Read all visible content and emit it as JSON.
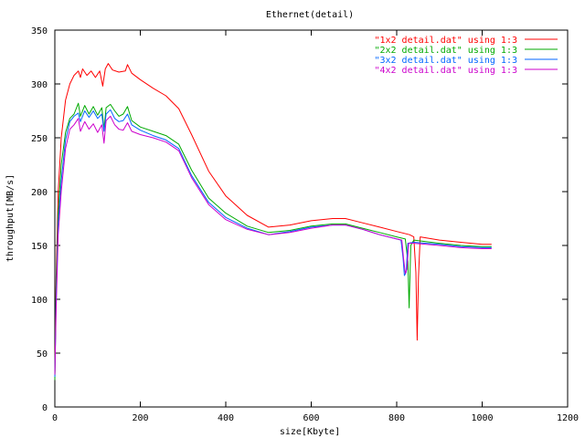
{
  "chart_data": {
    "type": "line",
    "title": "Ethernet(detail)",
    "xlabel": "size[Kbyte]",
    "ylabel": "throughput[MB/s]",
    "xlim": [
      0,
      1200
    ],
    "ylim": [
      0,
      350
    ],
    "xticks": [
      0,
      200,
      400,
      600,
      800,
      1000,
      1200
    ],
    "yticks": [
      0,
      50,
      100,
      150,
      200,
      250,
      300,
      350
    ],
    "grid": false,
    "legend_position": "top-right",
    "series": [
      {
        "name": "\"1x2 detail.dat\" using 1:3",
        "color": "#ff0000",
        "points": [
          [
            0,
            30
          ],
          [
            3,
            120
          ],
          [
            8,
            200
          ],
          [
            15,
            250
          ],
          [
            25,
            285
          ],
          [
            35,
            300
          ],
          [
            45,
            308
          ],
          [
            55,
            312
          ],
          [
            60,
            306
          ],
          [
            65,
            314
          ],
          [
            75,
            308
          ],
          [
            85,
            312
          ],
          [
            95,
            306
          ],
          [
            105,
            312
          ],
          [
            112,
            298
          ],
          [
            118,
            314
          ],
          [
            125,
            319
          ],
          [
            135,
            313
          ],
          [
            150,
            311
          ],
          [
            165,
            312
          ],
          [
            170,
            318
          ],
          [
            180,
            310
          ],
          [
            200,
            304
          ],
          [
            230,
            296
          ],
          [
            260,
            289
          ],
          [
            290,
            277
          ],
          [
            320,
            253
          ],
          [
            360,
            219
          ],
          [
            400,
            196
          ],
          [
            450,
            178
          ],
          [
            500,
            167
          ],
          [
            550,
            169
          ],
          [
            600,
            173
          ],
          [
            650,
            175
          ],
          [
            680,
            175
          ],
          [
            720,
            171
          ],
          [
            760,
            167
          ],
          [
            800,
            163
          ],
          [
            830,
            160
          ],
          [
            840,
            158
          ],
          [
            845,
            125
          ],
          [
            848,
            62
          ],
          [
            851,
            120
          ],
          [
            855,
            158
          ],
          [
            900,
            155
          ],
          [
            950,
            153
          ],
          [
            1000,
            151
          ],
          [
            1022,
            151
          ]
        ]
      },
      {
        "name": "\"2x2 detail.dat\" using 1:3",
        "color": "#00aa00",
        "points": [
          [
            0,
            25
          ],
          [
            3,
            110
          ],
          [
            8,
            180
          ],
          [
            15,
            225
          ],
          [
            25,
            255
          ],
          [
            35,
            268
          ],
          [
            45,
            272
          ],
          [
            55,
            282
          ],
          [
            60,
            270
          ],
          [
            70,
            280
          ],
          [
            80,
            272
          ],
          [
            90,
            279
          ],
          [
            100,
            271
          ],
          [
            110,
            278
          ],
          [
            115,
            258
          ],
          [
            120,
            278
          ],
          [
            130,
            281
          ],
          [
            140,
            275
          ],
          [
            150,
            270
          ],
          [
            160,
            272
          ],
          [
            170,
            279
          ],
          [
            180,
            266
          ],
          [
            200,
            260
          ],
          [
            230,
            256
          ],
          [
            260,
            252
          ],
          [
            290,
            244
          ],
          [
            320,
            220
          ],
          [
            360,
            194
          ],
          [
            400,
            180
          ],
          [
            450,
            168
          ],
          [
            500,
            162
          ],
          [
            550,
            164
          ],
          [
            600,
            168
          ],
          [
            650,
            170
          ],
          [
            680,
            170
          ],
          [
            720,
            166
          ],
          [
            760,
            162
          ],
          [
            800,
            158
          ],
          [
            820,
            156
          ],
          [
            826,
            135
          ],
          [
            829,
            92
          ],
          [
            833,
            150
          ],
          [
            840,
            155
          ],
          [
            900,
            152
          ],
          [
            950,
            150
          ],
          [
            1000,
            149
          ],
          [
            1022,
            149
          ]
        ]
      },
      {
        "name": "\"3x2 detail.dat\" using 1:3",
        "color": "#0066ff",
        "points": [
          [
            0,
            28
          ],
          [
            3,
            100
          ],
          [
            8,
            170
          ],
          [
            15,
            210
          ],
          [
            25,
            248
          ],
          [
            35,
            265
          ],
          [
            45,
            270
          ],
          [
            55,
            273
          ],
          [
            60,
            265
          ],
          [
            70,
            275
          ],
          [
            80,
            269
          ],
          [
            90,
            275
          ],
          [
            100,
            268
          ],
          [
            110,
            272
          ],
          [
            115,
            256
          ],
          [
            120,
            272
          ],
          [
            130,
            276
          ],
          [
            140,
            268
          ],
          [
            150,
            265
          ],
          [
            160,
            266
          ],
          [
            170,
            272
          ],
          [
            180,
            262
          ],
          [
            200,
            257
          ],
          [
            230,
            252
          ],
          [
            260,
            248
          ],
          [
            290,
            240
          ],
          [
            320,
            215
          ],
          [
            360,
            190
          ],
          [
            400,
            176
          ],
          [
            450,
            166
          ],
          [
            500,
            160
          ],
          [
            550,
            163
          ],
          [
            600,
            167
          ],
          [
            650,
            169
          ],
          [
            680,
            169
          ],
          [
            720,
            165
          ],
          [
            760,
            160
          ],
          [
            800,
            156
          ],
          [
            810,
            155
          ],
          [
            815,
            138
          ],
          [
            818,
            122
          ],
          [
            822,
            125
          ],
          [
            826,
            152
          ],
          [
            840,
            153
          ],
          [
            900,
            151
          ],
          [
            950,
            149
          ],
          [
            1000,
            148
          ],
          [
            1022,
            148
          ]
        ]
      },
      {
        "name": "\"4x2 detail.dat\" using 1:3",
        "color": "#cc00cc",
        "points": [
          [
            0,
            30
          ],
          [
            3,
            90
          ],
          [
            8,
            160
          ],
          [
            15,
            200
          ],
          [
            25,
            240
          ],
          [
            35,
            258
          ],
          [
            45,
            262
          ],
          [
            55,
            268
          ],
          [
            60,
            256
          ],
          [
            70,
            265
          ],
          [
            80,
            258
          ],
          [
            90,
            263
          ],
          [
            100,
            255
          ],
          [
            110,
            262
          ],
          [
            115,
            245
          ],
          [
            120,
            266
          ],
          [
            130,
            270
          ],
          [
            140,
            262
          ],
          [
            150,
            258
          ],
          [
            160,
            257
          ],
          [
            170,
            264
          ],
          [
            180,
            256
          ],
          [
            200,
            253
          ],
          [
            230,
            250
          ],
          [
            260,
            246
          ],
          [
            290,
            238
          ],
          [
            320,
            213
          ],
          [
            360,
            188
          ],
          [
            400,
            174
          ],
          [
            450,
            165
          ],
          [
            500,
            160
          ],
          [
            550,
            162
          ],
          [
            600,
            166
          ],
          [
            650,
            169
          ],
          [
            680,
            169
          ],
          [
            720,
            165
          ],
          [
            760,
            160
          ],
          [
            800,
            156
          ],
          [
            812,
            155
          ],
          [
            816,
            138
          ],
          [
            820,
            124
          ],
          [
            824,
            128
          ],
          [
            828,
            152
          ],
          [
            840,
            152
          ],
          [
            900,
            150
          ],
          [
            950,
            148
          ],
          [
            1000,
            147
          ],
          [
            1022,
            147
          ]
        ]
      }
    ]
  }
}
